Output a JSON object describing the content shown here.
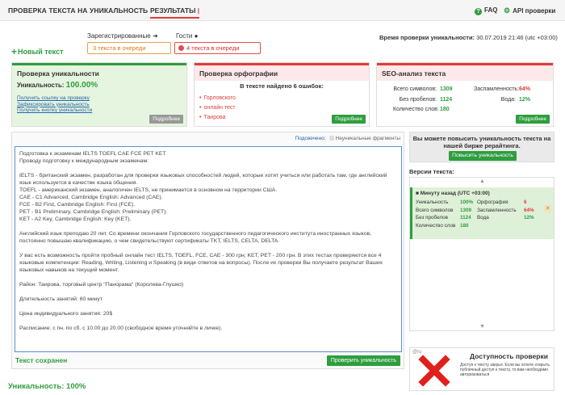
{
  "topbar": {
    "tab_check": "ПРОВЕРКА ТЕКСТА НА УНИКАЛЬНОСТЬ",
    "separator": ">",
    "tab_results": "РЕЗУЛЬТАТЫ",
    "faq": "FAQ",
    "api": "API проверки"
  },
  "queue": {
    "new_text": "Новый текст",
    "registered_label": "Зарегистрированные",
    "guests_label": "Гости",
    "registered_queue": "3 текста в очереди",
    "guests_queue": "4 текста в очереди",
    "time_label": "Время проверки уникальности:",
    "time_value": "30.07.2019 21:46 (utc +03:00)"
  },
  "uniqueness_panel": {
    "title": "Проверка уникальности",
    "label": "Уникальность:",
    "value": "100.00%",
    "links": [
      "Получить ссылку на проверку",
      "Зафиксировать уникальность",
      "Получить кнопку уникальности"
    ],
    "more": "Подробнее"
  },
  "spelling_panel": {
    "title": "Проверка орфографии",
    "found": "В тексте найдено 6 ошибок:",
    "errors": [
      "Горловского",
      "онлайн тест",
      "Таирова"
    ],
    "more": "Подробнее"
  },
  "seo_panel": {
    "title": "SEO-анализ текста",
    "left": [
      {
        "label": "Всего символов:",
        "value": "1309"
      },
      {
        "label": "Без пробелов:",
        "value": "1124"
      },
      {
        "label": "Количество слов:",
        "value": "180"
      }
    ],
    "right": [
      {
        "label": "Заспамленность:",
        "value": "64%"
      },
      {
        "label": "Вода:",
        "value": "12%"
      }
    ],
    "more": "Подробнее"
  },
  "editor": {
    "legend_highlighted": "Подсвечено:",
    "legend_nonunique": "Неуникальные фрагменты",
    "paragraphs": [
      "Подготовка к экзаменам IELTS TOEFL CAE FCE PET KET\nПроводу подготовку к международным экзаменам:",
      "IELTS - британский экзамен, разработан для проверки языковых способностей людей, которые хотят учиться или работать там, где английский язык используется в качестве языка общения.\nTOEFL - американский экзамен, аналогичен IELTS, не принимается в основном на территории США.\nCAE - C1 Advanced, Cambridge English: Advanced (CAE).\nFCE - B2 First, Cambridge English: First (FCE).\nPET - B1 Preliminary, Cambridge English: Preliminary (PET).\nKET - A2 Key, Cambridge English: Key (KET).",
      "Английский язык преподаю 20 лет. Со времени окончания Горловского государственного педагогического института иностранных языков, постоянно повышаю квалификацию, о чем свидетельствуют сертификаты TKT, IELTS, CELTA, DELTA.",
      "У вас есть возможность пройти пробный онлайн тест IELTS, TOEFL, FCE, CAE - 300 грн; KET, PET - 200 грн. В этих тестах проверяются все 4 языковые компетенции: Reading, Writing, Listening и Speaking (в виде ответов на вопросы). После их проверки Вы получаете результат Ваших языковых навыков на текущий момент.",
      "Район: Таирова, торговый центр \"Панорама\" (Королева-Глушко)",
      "Длительность занятий: 60 минут",
      "Цена индивидуального занятия: 20$",
      "Расписание: с пн. по сб. с 10.00 до 20.00 (свободное время уточняйте в личке)."
    ],
    "saved": "Текст сохранен",
    "check_button": "Проверить уникальность"
  },
  "final_uniqueness": "Уникальность: 100%",
  "promo": {
    "text": "Вы можете повысить уникальность текста на нашей бирже рерайтинга.",
    "button": "Повысить уникальность"
  },
  "versions": {
    "title": "Версии текста:",
    "item_title": "Минуту назад (UTC +03:00)",
    "rows_left": [
      {
        "label": "Уникальность",
        "value": "100%"
      },
      {
        "label": "Всего символов",
        "value": "1309"
      },
      {
        "label": "Без пробелов",
        "value": "1124"
      },
      {
        "label": "Количество слов",
        "value": "180"
      }
    ],
    "rows_right": [
      {
        "label": "Орфография",
        "value": "6"
      },
      {
        "label": "Заспамленность",
        "value": "64%"
      },
      {
        "label": "Вода",
        "value": "12%"
      }
    ]
  },
  "ad": {
    "logo": "@ru",
    "title": "Доступность проверки",
    "text": "Доступ к тексту закрыт. Если вы хотите открыть публичный доступ к тексту, то вам необходимо авторизоваться"
  },
  "colors": {
    "green": "#2e9e3e",
    "red": "#e23b3b",
    "link": "#2463a9",
    "orange": "#d57a14"
  }
}
